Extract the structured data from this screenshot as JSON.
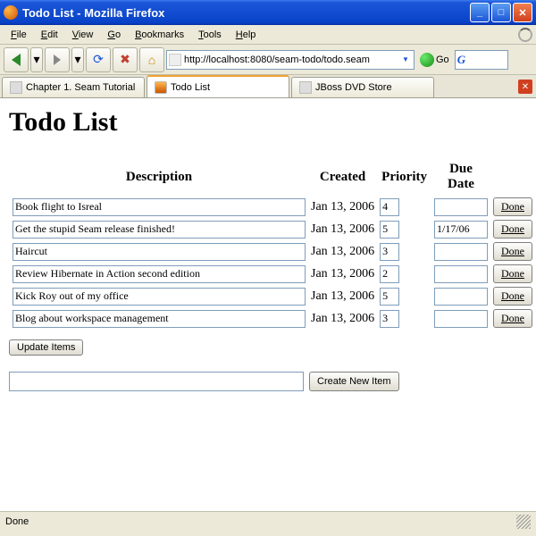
{
  "window": {
    "title": "Todo List - Mozilla Firefox"
  },
  "menu": {
    "file": "File",
    "edit": "Edit",
    "view": "View",
    "go": "Go",
    "bookmarks": "Bookmarks",
    "tools": "Tools",
    "help": "Help"
  },
  "nav": {
    "url": "http://localhost:8080/seam-todo/todo.seam",
    "go": "Go"
  },
  "tabs": [
    {
      "label": "Chapter 1. Seam Tutorial"
    },
    {
      "label": "Todo List"
    },
    {
      "label": "JBoss DVD Store"
    }
  ],
  "page": {
    "heading": "Todo List",
    "headers": {
      "description": "Description",
      "created": "Created",
      "priority": "Priority",
      "duedate": "Due Date"
    },
    "rows": [
      {
        "desc": "Book flight to Isreal",
        "created": "Jan 13, 2006",
        "priority": "4",
        "due": ""
      },
      {
        "desc": "Get the stupid Seam release finished!",
        "created": "Jan 13, 2006",
        "priority": "5",
        "due": "1/17/06"
      },
      {
        "desc": "Haircut",
        "created": "Jan 13, 2006",
        "priority": "3",
        "due": ""
      },
      {
        "desc": "Review Hibernate in Action second edition",
        "created": "Jan 13, 2006",
        "priority": "2",
        "due": ""
      },
      {
        "desc": "Kick Roy out of my office",
        "created": "Jan 13, 2006",
        "priority": "5",
        "due": ""
      },
      {
        "desc": "Blog about workspace management",
        "created": "Jan 13, 2006",
        "priority": "3",
        "due": ""
      }
    ],
    "done_label": "Done",
    "update_label": "Update Items",
    "create_label": "Create New Item"
  },
  "status": {
    "text": "Done"
  }
}
